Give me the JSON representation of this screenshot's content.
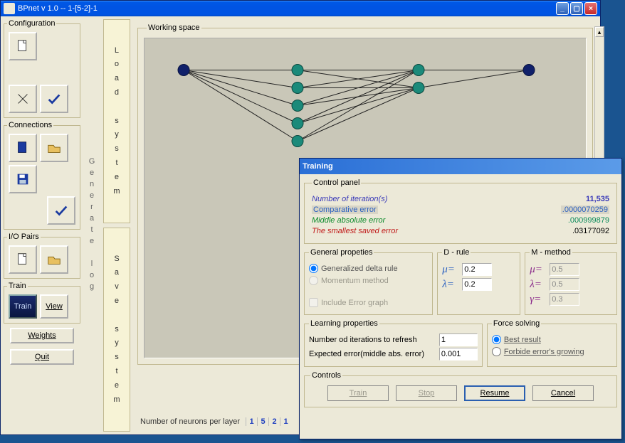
{
  "app": {
    "title": "BPnet v 1.0   --   1-[5-2]-1"
  },
  "sidebar": {
    "configuration_legend": "Configuration",
    "connections_legend": "Connections",
    "iopairs_legend": "I/O Pairs",
    "train_legend": "Train",
    "train_label": "Train",
    "view_label": "View",
    "weights_label": "Weights",
    "quit_label": "Quit"
  },
  "mid": {
    "generate_log": "Generate log"
  },
  "strips": {
    "load": "Load system",
    "save": "Save system"
  },
  "workspace": {
    "legend": "Working space",
    "status_label": "Number of neurons per layer",
    "layers": [
      "1",
      "5",
      "2",
      "1"
    ]
  },
  "dialog": {
    "title": "Training",
    "control_panel_legend": "Control panel",
    "metrics": {
      "iterations_label": "Number of iteration(s)",
      "iterations_value": "11,535",
      "comp_label": "Comparative error",
      "comp_value": ".0000070259",
      "mid_label": "Middle absolute error",
      "mid_value": ".000999879",
      "small_label": "The smallest saved error",
      "small_value": ".03177092"
    },
    "general": {
      "legend": "General propeties",
      "gdr": "Generalized delta rule",
      "momentum": "Momentum method",
      "include_err": "Include Error graph"
    },
    "drule": {
      "legend": "D - rule",
      "mu": "0.2",
      "lambda": "0.2"
    },
    "mmethod": {
      "legend": "M - method",
      "mu": "0.5",
      "lambda": "0.5",
      "gamma": "0.3"
    },
    "learning": {
      "legend": "Learning properties",
      "refresh_label": "Number od iterations to refresh",
      "refresh_value": "1",
      "expected_label": "Expected error(middle abs. error)",
      "expected_value": "0.001"
    },
    "force": {
      "legend": "Force solving",
      "best": "Best result",
      "forbide": "Forbide error's growing"
    },
    "controls": {
      "legend": "Controls",
      "train": "Train",
      "stop": "Stop",
      "resume": "Resume",
      "cancel": "Cancel"
    }
  }
}
